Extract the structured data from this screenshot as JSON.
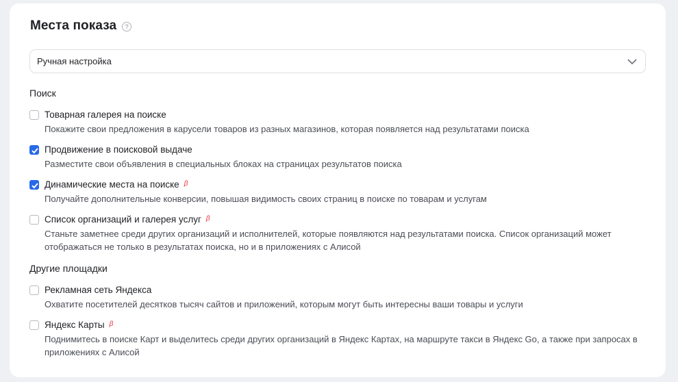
{
  "header": {
    "title": "Места показа",
    "help_icon": "question-circle-icon"
  },
  "mode_select": {
    "value": "Ручная настройка",
    "icon": "chevron-down-icon"
  },
  "sections": {
    "search": {
      "title": "Поиск",
      "options": [
        {
          "label": "Товарная галерея на поиске",
          "description": "Покажите свои предложения в карусели товаров из разных магазинов, которая появляется над результатами поиска",
          "checked": false,
          "beta": false
        },
        {
          "label": "Продвижение в поисковой выдаче",
          "description": "Разместите свои объявления в специальных блоках на страницах результатов поиска",
          "checked": true,
          "beta": false
        },
        {
          "label": "Динамические места на поиске",
          "description": "Получайте дополнительные конверсии, повышая видимость своих страниц в поиске по товарам и услугам",
          "checked": true,
          "beta": true
        },
        {
          "label": "Список организаций и галерея услуг",
          "description": "Станьте заметнее среди других организаций и исполнителей, которые появляются над результатами поиска. Список организаций может отображаться не только в результатах поиска, но и в приложениях с Алисой",
          "checked": false,
          "beta": true
        }
      ]
    },
    "other": {
      "title": "Другие площадки",
      "options": [
        {
          "label": "Рекламная сеть Яндекса",
          "description": "Охватите посетителей десятков тысяч сайтов и приложений, которым могут быть интересны ваши товары и услуги",
          "checked": false,
          "beta": false
        },
        {
          "label": "Яндекс Карты",
          "description": "Поднимитесь в поиске Карт и выделитесь среди других организаций в Яндекс Картах, на маршруте такси в Яндекс Go, а также при запросах в приложениях с Алисой",
          "checked": false,
          "beta": true
        }
      ]
    }
  },
  "beta_mark": "β",
  "colors": {
    "accent": "#2769e8",
    "beta": "#e5333a",
    "background": "#eef0f4"
  }
}
